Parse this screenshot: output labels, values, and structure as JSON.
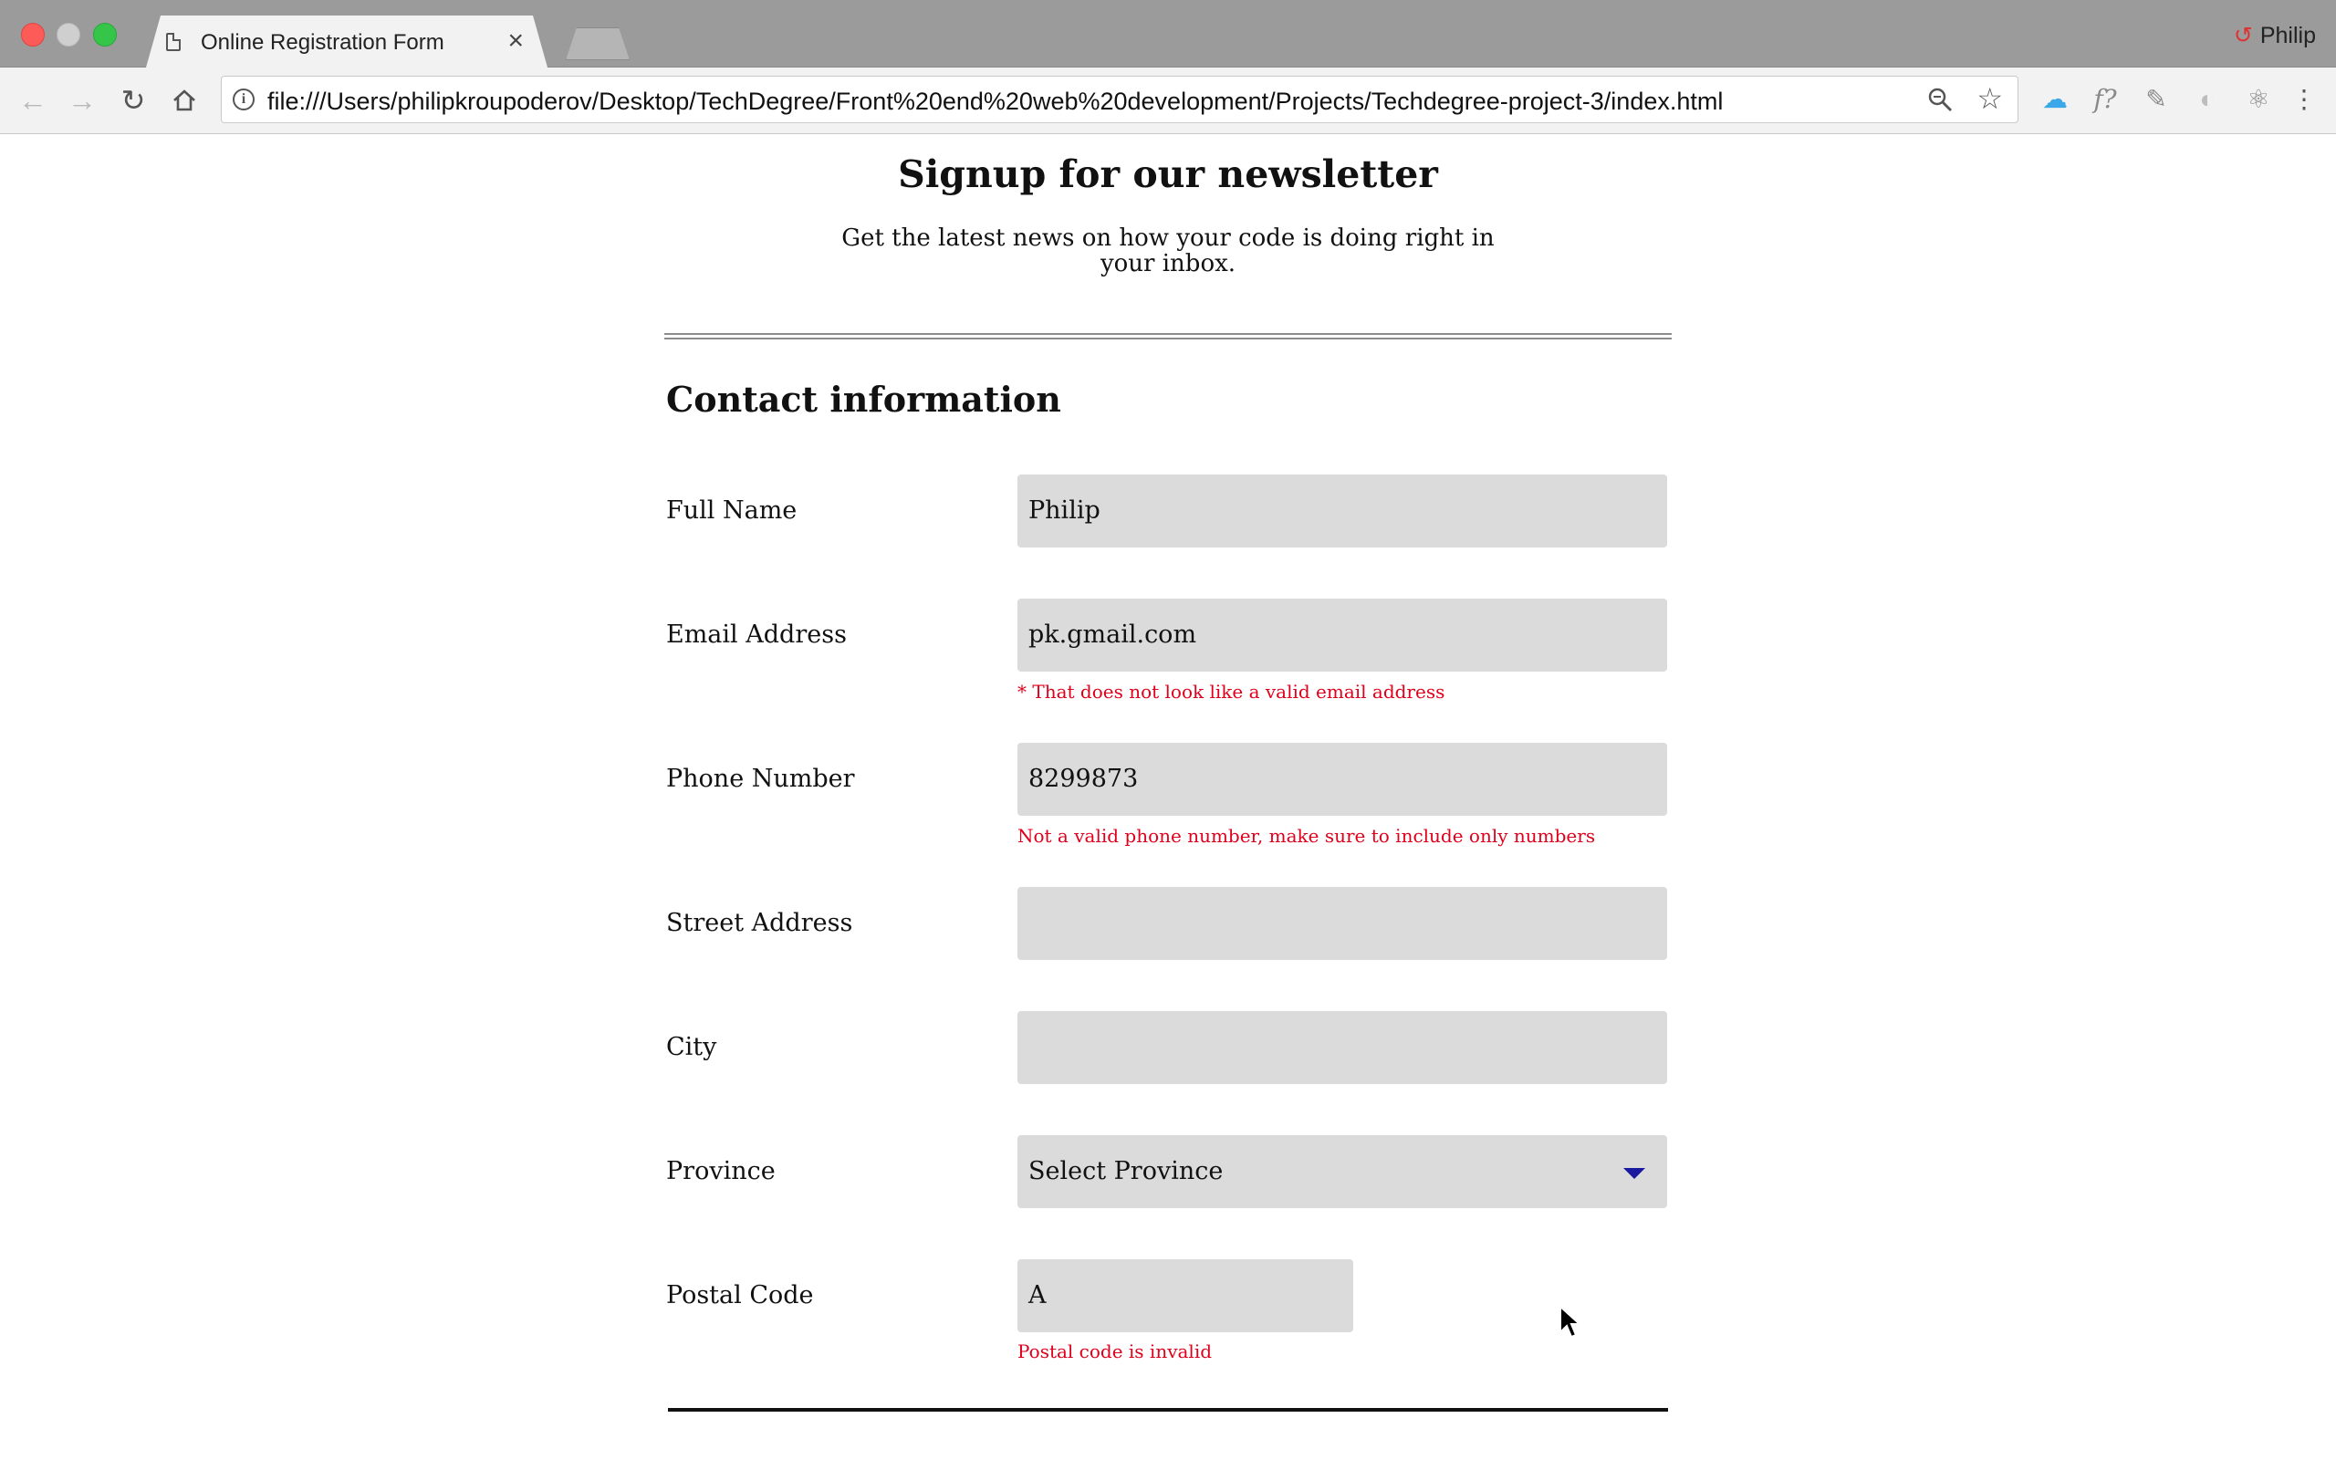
{
  "browser": {
    "tab_title": "Online Registration Form",
    "tab_close": "×",
    "profile_name": "Philip",
    "url": "file:///Users/philipkroupoderov/Desktop/TechDegree/Front%20end%20web%20development/Projects/Techdegree-project-3/index.html"
  },
  "page": {
    "title": "Signup for our newsletter",
    "subtitle": "Get the latest news on how your code is doing right in your inbox.",
    "section_title": "Contact information",
    "fields": {
      "full_name": {
        "label": "Full Name",
        "value": "Philip"
      },
      "email": {
        "label": "Email Address",
        "value": "pk.gmail.com",
        "error": "* That does not look like a valid email address"
      },
      "phone": {
        "label": "Phone Number",
        "value": "8299873",
        "error": "Not a valid phone number, make sure to include only numbers"
      },
      "street": {
        "label": "Street Address",
        "value": ""
      },
      "city": {
        "label": "City",
        "value": ""
      },
      "province": {
        "label": "Province",
        "value": "Select Province"
      },
      "postal": {
        "label": "Postal Code",
        "value": "A",
        "error": "Postal code is invalid"
      }
    }
  },
  "colors": {
    "error": "#e0001b",
    "field_bg": "#dbdbdb",
    "titlebar": "#9b9b9b",
    "select_caret": "#1a1a9e"
  }
}
